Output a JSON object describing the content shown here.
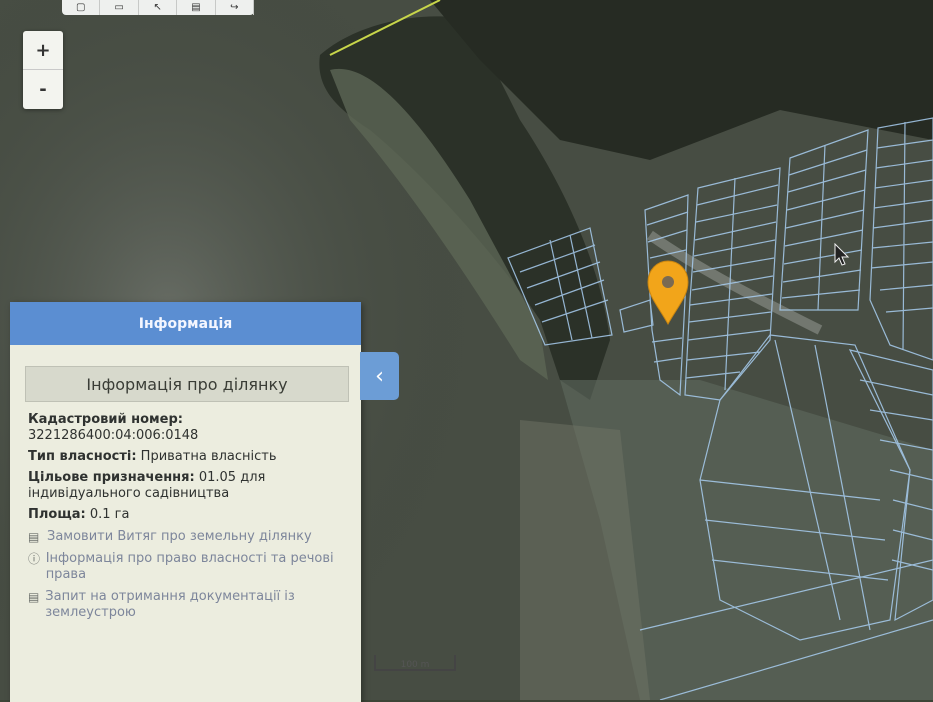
{
  "map": {
    "zoom_in_label": "+",
    "zoom_out_label": "-",
    "scale_label": "100 m",
    "toolbar_icons": [
      "measure-icon",
      "ruler-icon",
      "pointer-icon",
      "print-icon",
      "share-icon"
    ]
  },
  "panel": {
    "title": "Інформація",
    "subtitle": "Інформація про ділянку",
    "collapse_icon": "chevron-left-icon",
    "fields": [
      {
        "label": "Кадастровий номер:",
        "value": "3221286400:04:006:0148"
      },
      {
        "label": "Тип власності:",
        "value": "Приватна власність"
      },
      {
        "label": "Цільове призначення:",
        "value": "01.05 для індивідуального садівництва"
      },
      {
        "label": "Площа:",
        "value": "0.1 га"
      }
    ],
    "links": [
      {
        "icon": "document-icon",
        "label": "Замовити Витяг про земельну ділянку"
      },
      {
        "icon": "info-icon",
        "label": "Інформація про право власності та речові права"
      },
      {
        "icon": "document-icon",
        "label": "Запит на отримання документації із землеустрою"
      }
    ]
  },
  "colors": {
    "panel_header": "#5b8ed2",
    "parcel_outline": "#a8cdf0",
    "boundary_line": "#c8d64a",
    "marker": "#f2a51a"
  }
}
